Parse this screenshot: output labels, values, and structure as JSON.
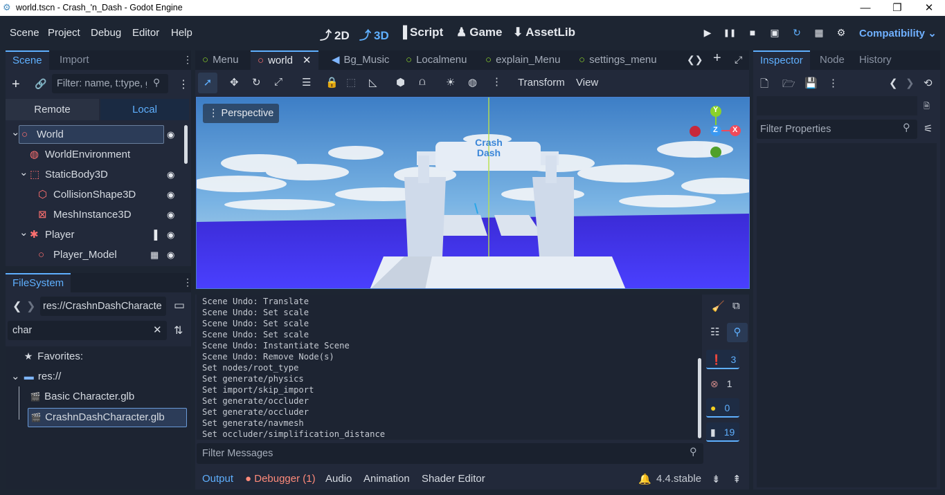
{
  "window": {
    "title": "world.tscn - Crash_'n_Dash - Godot Engine",
    "minimize": "—",
    "maximize": "❐",
    "close": "✕"
  },
  "menus": [
    "Scene",
    "Project",
    "Debug",
    "Editor",
    "Help"
  ],
  "workspaces": [
    {
      "label": "2D",
      "icon": "⤴"
    },
    {
      "label": "3D",
      "icon": "⤴"
    },
    {
      "label": "Script",
      "icon": "▐"
    },
    {
      "label": "Game",
      "icon": "♟"
    },
    {
      "label": "AssetLib",
      "icon": "⬇"
    }
  ],
  "run_buttons": [
    "▶",
    "❚❚",
    "■",
    "▣",
    "↻",
    "▦",
    "⚙"
  ],
  "renderer": "Compatibility",
  "scene_dock": {
    "tabs": [
      "Scene",
      "Import"
    ],
    "filter_placeholder": "Filter: name, t:type, g:group",
    "remote": "Remote",
    "local": "Local",
    "tree": [
      {
        "label": "World",
        "icon": "○",
        "color": "#ff7070",
        "indent": 0,
        "arrow": "⌄",
        "eye": true
      },
      {
        "label": "WorldEnvironment",
        "icon": "◍",
        "color": "#ff7070",
        "indent": 1,
        "arrow": "",
        "eye": false
      },
      {
        "label": "StaticBody3D",
        "icon": "⬚",
        "color": "#ff7070",
        "indent": 1,
        "arrow": "⌄",
        "eye": true
      },
      {
        "label": "CollisionShape3D",
        "icon": "⬡",
        "color": "#ff7070",
        "indent": 2,
        "arrow": "",
        "eye": true
      },
      {
        "label": "MeshInstance3D",
        "icon": "⊠",
        "color": "#ff7070",
        "indent": 2,
        "arrow": "",
        "eye": true
      },
      {
        "label": "Player",
        "icon": "✱",
        "color": "#ff7070",
        "indent": 1,
        "arrow": "⌄",
        "eye": true,
        "script": true
      },
      {
        "label": "Player_Model",
        "icon": "○",
        "color": "#ff7070",
        "indent": 2,
        "arrow": "",
        "eye": true,
        "clap": true
      }
    ]
  },
  "filesystem": {
    "title": "FileSystem",
    "path": "res://CrashnDashCharacte",
    "search": "char",
    "items": [
      {
        "label": "Favorites:",
        "icon": "★"
      },
      {
        "label": "res://",
        "icon": "▬"
      },
      {
        "label": "Basic Character.glb",
        "icon": "🎬"
      },
      {
        "label": "CrashnDashCharacter.glb",
        "icon": "🎬"
      }
    ]
  },
  "scene_tabs": [
    {
      "label": "Menu",
      "icon": "○"
    },
    {
      "label": "world",
      "icon": "○"
    },
    {
      "label": "Bg_Music",
      "icon": "◀"
    },
    {
      "label": "Localmenu",
      "icon": "○"
    },
    {
      "label": "explain_Menu",
      "icon": "○"
    },
    {
      "label": "settings_menu",
      "icon": "○"
    }
  ],
  "toolbar": {
    "transform": "Transform",
    "view": "View"
  },
  "viewport": {
    "label": "Perspective",
    "gizmo": {
      "y": "Y",
      "z": "Z",
      "x": "X"
    },
    "sign": "Crash Dash"
  },
  "output": {
    "log": [
      "Scene Undo: Translate",
      "Scene Undo: Set scale",
      "Scene Undo: Set scale",
      "Scene Undo: Set scale",
      "Scene Undo: Instantiate Scene",
      "Scene Undo: Remove Node(s)",
      "Set nodes/root_type",
      "Set generate/physics",
      "Set import/skip_import",
      "Set generate/occluder",
      "Set generate/occluder",
      "Set generate/navmesh",
      "Set occluder/simplification_distance"
    ],
    "filter_placeholder": "Filter Messages",
    "counts": [
      "3",
      "1",
      "0",
      "19"
    ]
  },
  "bottom_tabs": {
    "output": "Output",
    "debugger": "Debugger (1)",
    "audio": "Audio",
    "animation": "Animation",
    "shader": "Shader Editor",
    "version": "4.4.stable"
  },
  "inspector": {
    "tabs": [
      "Inspector",
      "Node",
      "History"
    ],
    "filter_placeholder": "Filter Properties"
  }
}
